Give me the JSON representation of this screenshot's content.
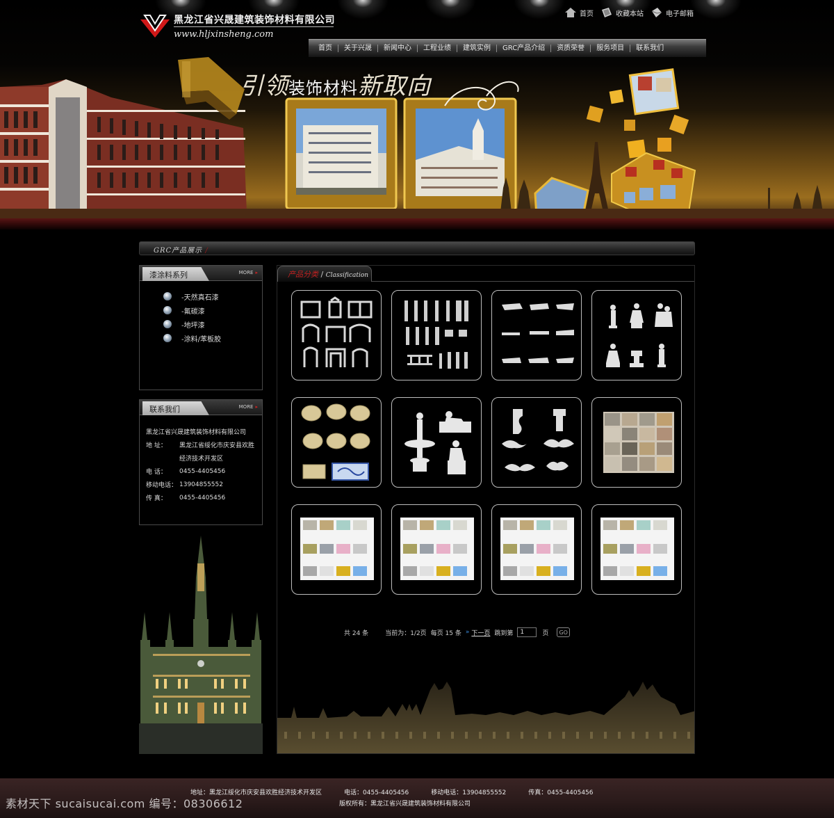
{
  "header": {
    "company_name": "黑龙江省兴晟建筑装饰材料有限公司",
    "url": "www.hljxinsheng.com",
    "slogan_a": "引领",
    "slogan_b": "装饰材料",
    "slogan_c": "新取向",
    "top_links": [
      {
        "label": "首页",
        "icon": "home-icon"
      },
      {
        "label": "收藏本站",
        "icon": "bookmark-icon"
      },
      {
        "label": "电子邮箱",
        "icon": "mail-icon"
      }
    ]
  },
  "nav": [
    "首页",
    "关于兴晟",
    "新闻中心",
    "工程业绩",
    "建筑实例",
    "GRC产品介绍",
    "资质荣誉",
    "服务项目",
    "联系我们"
  ],
  "breadcrumb": {
    "title": "GRC产品展示",
    "separator": "/"
  },
  "sidebar": {
    "category_box": {
      "title": "漆涂料系列",
      "more": "MORE",
      "items": [
        "-天然真石漆",
        "-氟碳漆",
        "-地坪漆",
        "-涂料/苯板胶"
      ]
    },
    "contact_box": {
      "title": "联系我们",
      "more": "MORE",
      "company": "黑龙江省兴晟建筑装饰材料有限公司",
      "address_key": "地    址：",
      "address_1": "黑龙江省绥化市庆安县欢胜",
      "address_2": "经济技术开发区",
      "phone_key": "电    话：",
      "phone": "0455-4405456",
      "mobile_key": "移动电话：",
      "mobile": "13904855552",
      "fax_key": "传    真：",
      "fax": "0455-4405456"
    }
  },
  "panel": {
    "tab_cn": "产品分类",
    "tab_sep": "/",
    "tab_en": "Classification",
    "products": [
      "window-frames",
      "columns",
      "cornices",
      "statues",
      "medallions",
      "sculptures",
      "corbels",
      "stone-swatches",
      "color-chart",
      "color-chart",
      "color-chart",
      "color-chart"
    ]
  },
  "pager": {
    "total": "共 24 条",
    "current": "当前为：1/2页",
    "per_page": "每页 15 条",
    "next": "下一页",
    "jump": "跳到第",
    "page_value": "1",
    "page_unit": "页",
    "go": "GO"
  },
  "footer": {
    "address": "地址：黑龙江绥化市庆安县欢胜经济技术开发区",
    "phone": "电话：0455-4405456",
    "mobile": "移动电话：13904855552",
    "fax": "传真：0455-4405456",
    "copyright": "版权所有：黑龙江省兴晟建筑装饰材料有限公司"
  },
  "watermark": "素材天下 sucaisucai.com  编号：08306612",
  "colors": {
    "accent_red": "#c02020",
    "gold": "#c8961e",
    "panel_border": "#bdbdbd"
  }
}
